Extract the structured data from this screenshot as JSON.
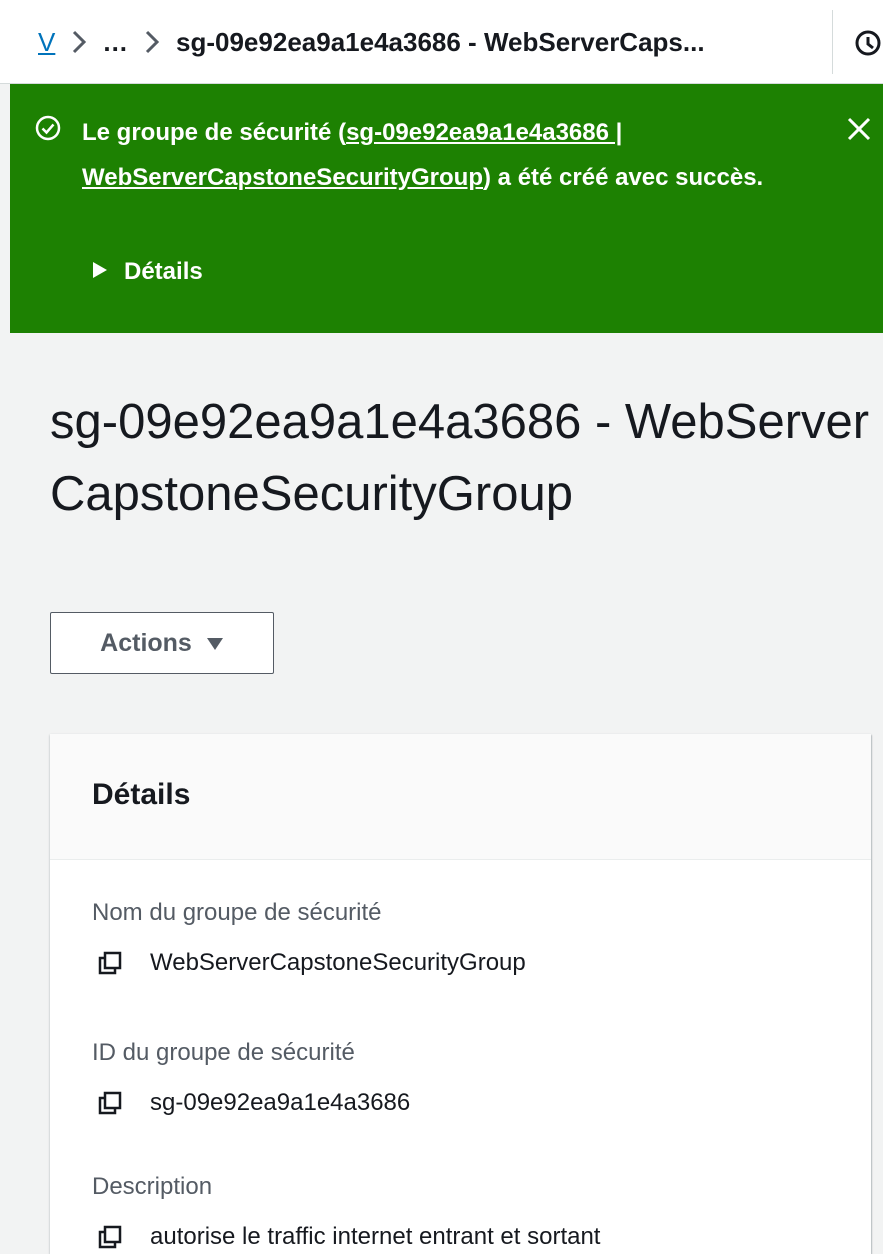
{
  "breadcrumb": {
    "root_link": "V",
    "ellipsis": "...",
    "current": "sg-09e92ea9a1e4a3686 - WebServerCaps..."
  },
  "flash": {
    "text_before": "Le groupe de sécurité (",
    "link_line1": "sg-09e92ea9a1e4a3686 |",
    "link_line2": "WebServerCapstoneSecurityGroup",
    "text_after": ") a été créé avec succès.",
    "details_label": "Détails",
    "color": "#1d8102"
  },
  "page": {
    "title": "sg-09e92ea9a1e4a3686 - WebServerCapstoneSecurityGroup",
    "actions_label": "Actions"
  },
  "details_panel": {
    "title": "Détails",
    "fields": [
      {
        "label": "Nom du groupe de sécurité",
        "value": "WebServerCapstoneSecurityGroup",
        "icon": "copy-icon"
      },
      {
        "label": "ID du groupe de sécurité",
        "value": "sg-09e92ea9a1e4a3686",
        "icon": "copy-icon"
      },
      {
        "label": "Description",
        "value": "autorise le traffic internet entrant et sortant",
        "icon": "copy-icon"
      }
    ]
  },
  "colors": {
    "link": "#0073bb",
    "success": "#1d8102",
    "text": "#16191f",
    "muted": "#545b64"
  }
}
